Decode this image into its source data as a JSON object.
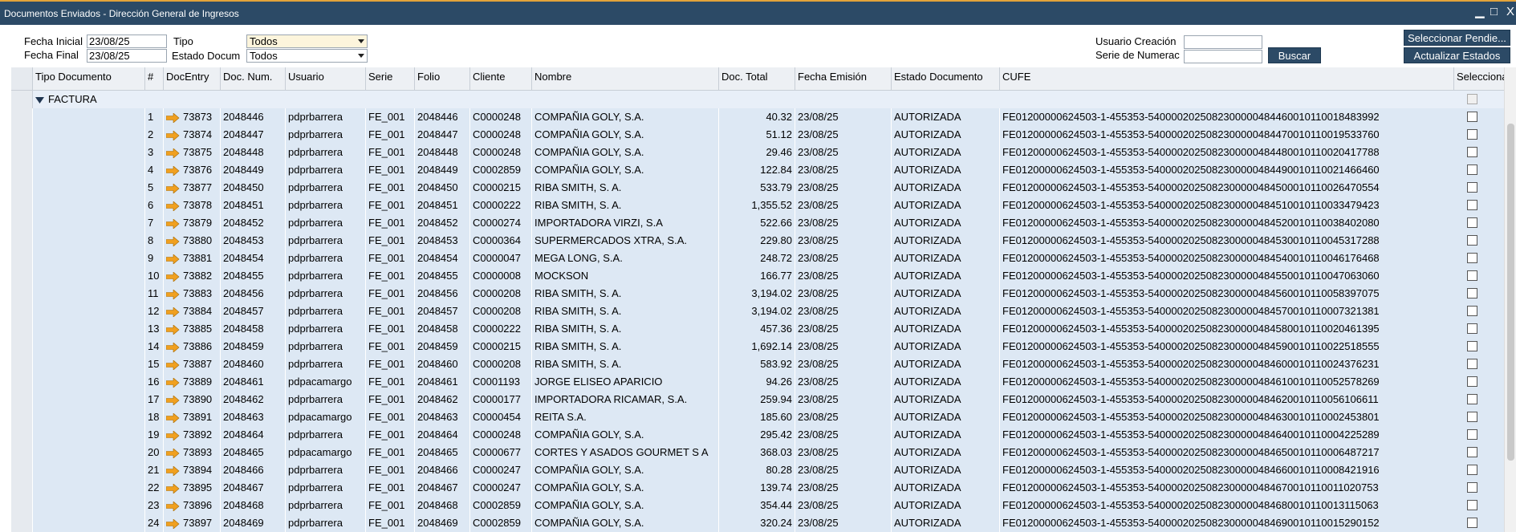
{
  "window": {
    "title": "Documentos Enviados - Dirección General de Ingresos",
    "minimize": "▁",
    "maximize": "□",
    "close": "X"
  },
  "filters": {
    "fecha_inicial_label": "Fecha Inicial",
    "fecha_inicial_value": "23/08/25",
    "fecha_final_label": "Fecha Final",
    "fecha_final_value": "23/08/25",
    "tipo_label": "Tipo",
    "tipo_value": "Todos",
    "estado_label": "Estado Docum",
    "estado_value": "Todos",
    "usuario_label": "Usuario Creación",
    "usuario_value": "",
    "serie_label": "Serie de Numerac",
    "serie_value": ""
  },
  "buttons": {
    "buscar": "Buscar",
    "seleccionar_pendientes": "Seleccionar Pendie...",
    "actualizar_estados": "Actualizar Estados"
  },
  "columns": [
    "Tipo Documento",
    "#",
    "DocEntry",
    "Doc. Num.",
    "Usuario",
    "Serie",
    "Folio",
    "Cliente",
    "Nombre",
    "Doc. Total",
    "Fecha Emisión",
    "Estado Documento",
    "CUFE",
    "Seleccionar"
  ],
  "group": {
    "label": "FACTURA"
  },
  "colors": {
    "titlebar": "#2c4a66",
    "accent": "#e3a33a",
    "row": "#dde8f4",
    "link_arrow": "#f0a020"
  },
  "rows": [
    {
      "n": "1",
      "entry": "73873",
      "num": "2048446",
      "user": "pdprbarrera",
      "serie": "FE_001",
      "folio": "2048446",
      "cliente": "C0000248",
      "nombre": "COMPAÑIA GOLY, S.A.",
      "total": "40.32",
      "fecha": "23/08/25",
      "estado": "AUTORIZADA",
      "cufe": "FE01200000624503-1-455353-5400002025082300000484460010110018483992"
    },
    {
      "n": "2",
      "entry": "73874",
      "num": "2048447",
      "user": "pdprbarrera",
      "serie": "FE_001",
      "folio": "2048447",
      "cliente": "C0000248",
      "nombre": "COMPAÑIA GOLY, S.A.",
      "total": "51.12",
      "fecha": "23/08/25",
      "estado": "AUTORIZADA",
      "cufe": "FE01200000624503-1-455353-5400002025082300000484470010110019533760"
    },
    {
      "n": "3",
      "entry": "73875",
      "num": "2048448",
      "user": "pdprbarrera",
      "serie": "FE_001",
      "folio": "2048448",
      "cliente": "C0000248",
      "nombre": "COMPAÑIA GOLY, S.A.",
      "total": "29.46",
      "fecha": "23/08/25",
      "estado": "AUTORIZADA",
      "cufe": "FE01200000624503-1-455353-5400002025082300000484480010110020417788"
    },
    {
      "n": "4",
      "entry": "73876",
      "num": "2048449",
      "user": "pdprbarrera",
      "serie": "FE_001",
      "folio": "2048449",
      "cliente": "C0002859",
      "nombre": "COMPAÑIA GOLY, S.A.",
      "total": "122.84",
      "fecha": "23/08/25",
      "estado": "AUTORIZADA",
      "cufe": "FE01200000624503-1-455353-5400002025082300000484490010110021466460"
    },
    {
      "n": "5",
      "entry": "73877",
      "num": "2048450",
      "user": "pdprbarrera",
      "serie": "FE_001",
      "folio": "2048450",
      "cliente": "C0000215",
      "nombre": "RIBA SMITH, S. A.",
      "total": "533.79",
      "fecha": "23/08/25",
      "estado": "AUTORIZADA",
      "cufe": "FE01200000624503-1-455353-5400002025082300000484500010110026470554"
    },
    {
      "n": "6",
      "entry": "73878",
      "num": "2048451",
      "user": "pdprbarrera",
      "serie": "FE_001",
      "folio": "2048451",
      "cliente": "C0000222",
      "nombre": "RIBA SMITH, S. A.",
      "total": "1,355.52",
      "fecha": "23/08/25",
      "estado": "AUTORIZADA",
      "cufe": "FE01200000624503-1-455353-5400002025082300000484510010110033479423"
    },
    {
      "n": "7",
      "entry": "73879",
      "num": "2048452",
      "user": "pdprbarrera",
      "serie": "FE_001",
      "folio": "2048452",
      "cliente": "C0000274",
      "nombre": "IMPORTADORA VIRZI, S.A",
      "total": "522.66",
      "fecha": "23/08/25",
      "estado": "AUTORIZADA",
      "cufe": "FE01200000624503-1-455353-5400002025082300000484520010110038402080"
    },
    {
      "n": "8",
      "entry": "73880",
      "num": "2048453",
      "user": "pdprbarrera",
      "serie": "FE_001",
      "folio": "2048453",
      "cliente": "C0000364",
      "nombre": "SUPERMERCADOS XTRA, S.A.",
      "total": "229.80",
      "fecha": "23/08/25",
      "estado": "AUTORIZADA",
      "cufe": "FE01200000624503-1-455353-5400002025082300000484530010110045317288"
    },
    {
      "n": "9",
      "entry": "73881",
      "num": "2048454",
      "user": "pdprbarrera",
      "serie": "FE_001",
      "folio": "2048454",
      "cliente": "C0000047",
      "nombre": "MEGA LONG, S.A.",
      "total": "248.72",
      "fecha": "23/08/25",
      "estado": "AUTORIZADA",
      "cufe": "FE01200000624503-1-455353-5400002025082300000484540010110046176468"
    },
    {
      "n": "10",
      "entry": "73882",
      "num": "2048455",
      "user": "pdprbarrera",
      "serie": "FE_001",
      "folio": "2048455",
      "cliente": "C0000008",
      "nombre": "MOCKSON",
      "total": "166.77",
      "fecha": "23/08/25",
      "estado": "AUTORIZADA",
      "cufe": "FE01200000624503-1-455353-5400002025082300000484550010110047063060"
    },
    {
      "n": "11",
      "entry": "73883",
      "num": "2048456",
      "user": "pdprbarrera",
      "serie": "FE_001",
      "folio": "2048456",
      "cliente": "C0000208",
      "nombre": "RIBA SMITH, S. A.",
      "total": "3,194.02",
      "fecha": "23/08/25",
      "estado": "AUTORIZADA",
      "cufe": "FE01200000624503-1-455353-5400002025082300000484560010110058397075"
    },
    {
      "n": "12",
      "entry": "73884",
      "num": "2048457",
      "user": "pdprbarrera",
      "serie": "FE_001",
      "folio": "2048457",
      "cliente": "C0000208",
      "nombre": "RIBA SMITH, S. A.",
      "total": "3,194.02",
      "fecha": "23/08/25",
      "estado": "AUTORIZADA",
      "cufe": "FE01200000624503-1-455353-5400002025082300000484570010110007321381"
    },
    {
      "n": "13",
      "entry": "73885",
      "num": "2048458",
      "user": "pdprbarrera",
      "serie": "FE_001",
      "folio": "2048458",
      "cliente": "C0000222",
      "nombre": "RIBA SMITH, S. A.",
      "total": "457.36",
      "fecha": "23/08/25",
      "estado": "AUTORIZADA",
      "cufe": "FE01200000624503-1-455353-5400002025082300000484580010110020461395"
    },
    {
      "n": "14",
      "entry": "73886",
      "num": "2048459",
      "user": "pdprbarrera",
      "serie": "FE_001",
      "folio": "2048459",
      "cliente": "C0000215",
      "nombre": "RIBA SMITH, S. A.",
      "total": "1,692.14",
      "fecha": "23/08/25",
      "estado": "AUTORIZADA",
      "cufe": "FE01200000624503-1-455353-5400002025082300000484590010110022518555"
    },
    {
      "n": "15",
      "entry": "73887",
      "num": "2048460",
      "user": "pdprbarrera",
      "serie": "FE_001",
      "folio": "2048460",
      "cliente": "C0000208",
      "nombre": "RIBA SMITH, S. A.",
      "total": "583.92",
      "fecha": "23/08/25",
      "estado": "AUTORIZADA",
      "cufe": "FE01200000624503-1-455353-5400002025082300000484600010110024376231"
    },
    {
      "n": "16",
      "entry": "73889",
      "num": "2048461",
      "user": "pdpacamargo",
      "serie": "FE_001",
      "folio": "2048461",
      "cliente": "C0001193",
      "nombre": "JORGE ELISEO APARICIO",
      "total": "94.26",
      "fecha": "23/08/25",
      "estado": "AUTORIZADA",
      "cufe": "FE01200000624503-1-455353-5400002025082300000484610010110052578269"
    },
    {
      "n": "17",
      "entry": "73890",
      "num": "2048462",
      "user": "pdprbarrera",
      "serie": "FE_001",
      "folio": "2048462",
      "cliente": "C0000177",
      "nombre": "IMPORTADORA RICAMAR, S.A.",
      "total": "259.94",
      "fecha": "23/08/25",
      "estado": "AUTORIZADA",
      "cufe": "FE01200000624503-1-455353-5400002025082300000484620010110056106611"
    },
    {
      "n": "18",
      "entry": "73891",
      "num": "2048463",
      "user": "pdpacamargo",
      "serie": "FE_001",
      "folio": "2048463",
      "cliente": "C0000454",
      "nombre": "REITA S.A.",
      "total": "185.60",
      "fecha": "23/08/25",
      "estado": "AUTORIZADA",
      "cufe": "FE01200000624503-1-455353-5400002025082300000484630010110002453801"
    },
    {
      "n": "19",
      "entry": "73892",
      "num": "2048464",
      "user": "pdprbarrera",
      "serie": "FE_001",
      "folio": "2048464",
      "cliente": "C0000248",
      "nombre": "COMPAÑIA GOLY, S.A.",
      "total": "295.42",
      "fecha": "23/08/25",
      "estado": "AUTORIZADA",
      "cufe": "FE01200000624503-1-455353-5400002025082300000484640010110004225289"
    },
    {
      "n": "20",
      "entry": "73893",
      "num": "2048465",
      "user": "pdpacamargo",
      "serie": "FE_001",
      "folio": "2048465",
      "cliente": "C0000677",
      "nombre": "CORTES Y ASADOS GOURMET S A",
      "total": "368.03",
      "fecha": "23/08/25",
      "estado": "AUTORIZADA",
      "cufe": "FE01200000624503-1-455353-5400002025082300000484650010110006487217"
    },
    {
      "n": "21",
      "entry": "73894",
      "num": "2048466",
      "user": "pdprbarrera",
      "serie": "FE_001",
      "folio": "2048466",
      "cliente": "C0000247",
      "nombre": "COMPAÑIA GOLY, S.A.",
      "total": "80.28",
      "fecha": "23/08/25",
      "estado": "AUTORIZADA",
      "cufe": "FE01200000624503-1-455353-5400002025082300000484660010110008421916"
    },
    {
      "n": "22",
      "entry": "73895",
      "num": "2048467",
      "user": "pdprbarrera",
      "serie": "FE_001",
      "folio": "2048467",
      "cliente": "C0000247",
      "nombre": "COMPAÑIA GOLY, S.A.",
      "total": "139.74",
      "fecha": "23/08/25",
      "estado": "AUTORIZADA",
      "cufe": "FE01200000624503-1-455353-5400002025082300000484670010110011020753"
    },
    {
      "n": "23",
      "entry": "73896",
      "num": "2048468",
      "user": "pdprbarrera",
      "serie": "FE_001",
      "folio": "2048468",
      "cliente": "C0002859",
      "nombre": "COMPAÑIA GOLY, S.A.",
      "total": "354.44",
      "fecha": "23/08/25",
      "estado": "AUTORIZADA",
      "cufe": "FE01200000624503-1-455353-5400002025082300000484680010110013115063"
    },
    {
      "n": "24",
      "entry": "73897",
      "num": "2048469",
      "user": "pdprbarrera",
      "serie": "FE_001",
      "folio": "2048469",
      "cliente": "C0002859",
      "nombre": "COMPAÑIA GOLY, S.A.",
      "total": "320.24",
      "fecha": "23/08/25",
      "estado": "AUTORIZADA",
      "cufe": "FE01200000624503-1-455353-5400002025082300000484690010110015290152"
    }
  ]
}
